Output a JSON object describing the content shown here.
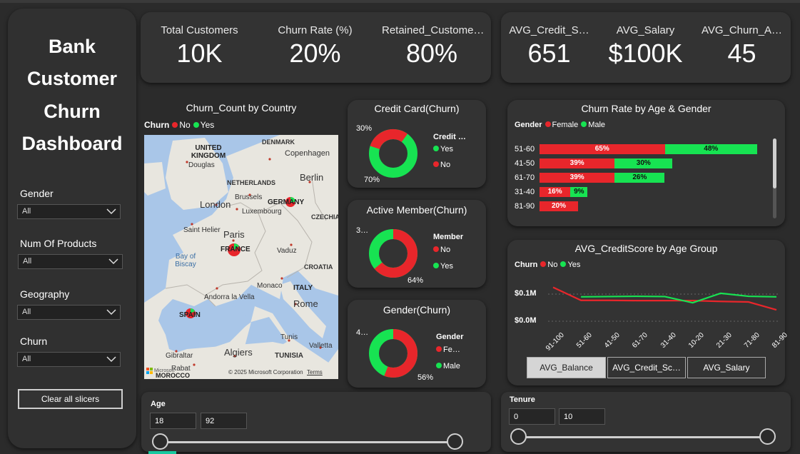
{
  "sidebar": {
    "title_lines": [
      "Bank",
      "Customer",
      "Churn",
      "Dashboard"
    ],
    "slicers": [
      {
        "label": "Gender",
        "value": "All"
      },
      {
        "label": "Num Of Products",
        "value": "All"
      },
      {
        "label": "Geography",
        "value": "All"
      },
      {
        "label": "Churn",
        "value": "All"
      }
    ],
    "clear_label": "Clear all slicers"
  },
  "kpis_left": [
    {
      "label": "Total Customers",
      "value": "10K"
    },
    {
      "label": "Churn Rate (%)",
      "value": "20%"
    },
    {
      "label": "Retained_Custome…",
      "value": "80%"
    }
  ],
  "kpis_right": [
    {
      "label": "AVG_Credit_S…",
      "value": "651"
    },
    {
      "label": "AVG_Salary",
      "value": "$100K"
    },
    {
      "label": "AVG_Churn_A…",
      "value": "45"
    }
  ],
  "colors": {
    "no": "#e8262b",
    "yes": "#17e352",
    "panel": "#333333"
  },
  "map": {
    "title": "Churn_Count by Country",
    "legend_title": "Churn",
    "legend_no": "No",
    "legend_yes": "Yes",
    "labels": {
      "uk": "UNITED KINGDOM",
      "douglas": "Douglas",
      "london": "London",
      "denmark": "DENMARK",
      "copenhagen": "Copenhagen",
      "netherlands": "NETHERLANDS",
      "berlin": "Berlin",
      "brussels": "Brussels",
      "luxembourg": "Luxembourg",
      "germany": "GERMANY",
      "czechia": "CZECHIA",
      "saint_helier": "Saint Helier",
      "paris": "Paris",
      "france": "FRANCE",
      "vaduz": "Vaduz",
      "bay": "Bay of Biscay",
      "croatia": "CROATIA",
      "monaco": "Monaco",
      "italy": "ITALY",
      "andorra": "Andorra la Vella",
      "rome": "Rome",
      "spain": "SPAIN",
      "tunis": "Tunis",
      "valletta": "Valletta",
      "gibraltar": "Gibraltar",
      "algiers": "Algiers",
      "tunisia": "TUNISIA",
      "rabat": "Rabat",
      "morocco": "MOROCCO",
      "copyright": "© 2025 Microsoft Corporation",
      "terms": "Terms",
      "ms": "Microsoft"
    }
  },
  "donuts": [
    {
      "title": "Credit Card(Churn)",
      "legend_title": "Credit …",
      "legend": [
        "Yes",
        "No"
      ],
      "label_top": "30%",
      "label_bottom": "70%",
      "no_share": 0.3
    },
    {
      "title": "Active Member(Churn)",
      "legend_title": "Member",
      "legend": [
        "No",
        "Yes"
      ],
      "label_top": "3…",
      "label_bottom": "64%",
      "no_share": 0.64
    },
    {
      "title": "Gender(Churn)",
      "legend_title": "Gender",
      "legend": [
        "Fe…",
        "Male"
      ],
      "label_top": "4…",
      "label_bottom": "56%",
      "no_share": 0.56
    }
  ],
  "age_gender": {
    "title": "Churn Rate by Age & Gender",
    "legend_title": "Gender",
    "legend_female": "Female",
    "legend_male": "Male"
  },
  "line_chart": {
    "title": "AVG_CreditScore by Age Group",
    "legend_title": "Churn",
    "legend_no": "No",
    "legend_yes": "Yes",
    "y_ticks": [
      "$0.1M",
      "$0.0M"
    ],
    "tabs": [
      "AVG_Balance",
      "AVG_Credit_Sc…",
      "AVG_Salary"
    ]
  },
  "chart_data": [
    {
      "type": "bar",
      "title": "Churn Rate by Age & Gender",
      "categories": [
        "51-60",
        "41-50",
        "61-70",
        "31-40",
        "81-90"
      ],
      "series": [
        {
          "name": "Female",
          "values": [
            65,
            39,
            39,
            16,
            20
          ]
        },
        {
          "name": "Male",
          "values": [
            48,
            30,
            26,
            9,
            null
          ]
        }
      ]
    },
    {
      "type": "line",
      "title": "AVG_CreditScore by Age Group",
      "categories": [
        "91-100",
        "51-60",
        "41-50",
        "61-70",
        "31-40",
        "10-20",
        "21-30",
        "71-80",
        "81-90"
      ],
      "series": [
        {
          "name": "No",
          "values": [
            0.125,
            0.077,
            0.077,
            0.076,
            0.076,
            0.076,
            0.073,
            0.071,
            0.042
          ]
        },
        {
          "name": "Yes",
          "values": [
            null,
            0.09,
            0.091,
            0.092,
            0.091,
            0.068,
            0.103,
            0.092,
            0.09
          ]
        }
      ],
      "y_ticks": [
        "$0.0M",
        "$0.1M"
      ]
    }
  ],
  "age_slicer": {
    "label": "Age",
    "min": "18",
    "max": "92"
  },
  "tenure_slicer": {
    "label": "Tenure",
    "min": "0",
    "max": "10"
  }
}
